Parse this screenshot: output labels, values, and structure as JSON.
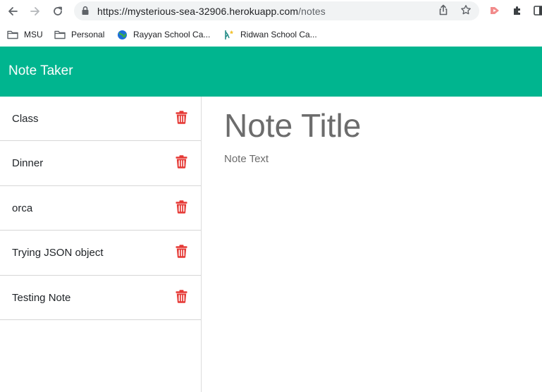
{
  "browser": {
    "url_host": "https://mysterious-sea-32906.herokuapp.com",
    "url_path": "/notes",
    "icons": {
      "back": "arrow-left-icon",
      "forward": "arrow-right-icon",
      "reload": "reload-icon",
      "lock": "lock-icon",
      "share": "share-icon",
      "bookmark": "star-icon",
      "extension1": "red-extension-icon",
      "extensions": "puzzle-icon",
      "sidepanel": "side-panel-icon"
    }
  },
  "bookmarks": [
    {
      "label": "MSU",
      "icon": "folder-icon"
    },
    {
      "label": "Personal",
      "icon": "folder-icon"
    },
    {
      "label": "Rayyan School Ca...",
      "icon": "globe-icon"
    },
    {
      "label": "Ridwan School Ca...",
      "icon": "site-icon"
    }
  ],
  "app": {
    "brand": "Note Taker",
    "colors": {
      "navbar": "#00b58f",
      "trash": "#e53935",
      "text": "#212529",
      "muted": "#6c6c6c"
    }
  },
  "notes": [
    {
      "title": "Class"
    },
    {
      "title": "Dinner"
    },
    {
      "title": "orca"
    },
    {
      "title": "Trying JSON object"
    },
    {
      "title": "Testing Note"
    }
  ],
  "editor": {
    "title_placeholder": "Note Title",
    "text_placeholder": "Note Text"
  }
}
